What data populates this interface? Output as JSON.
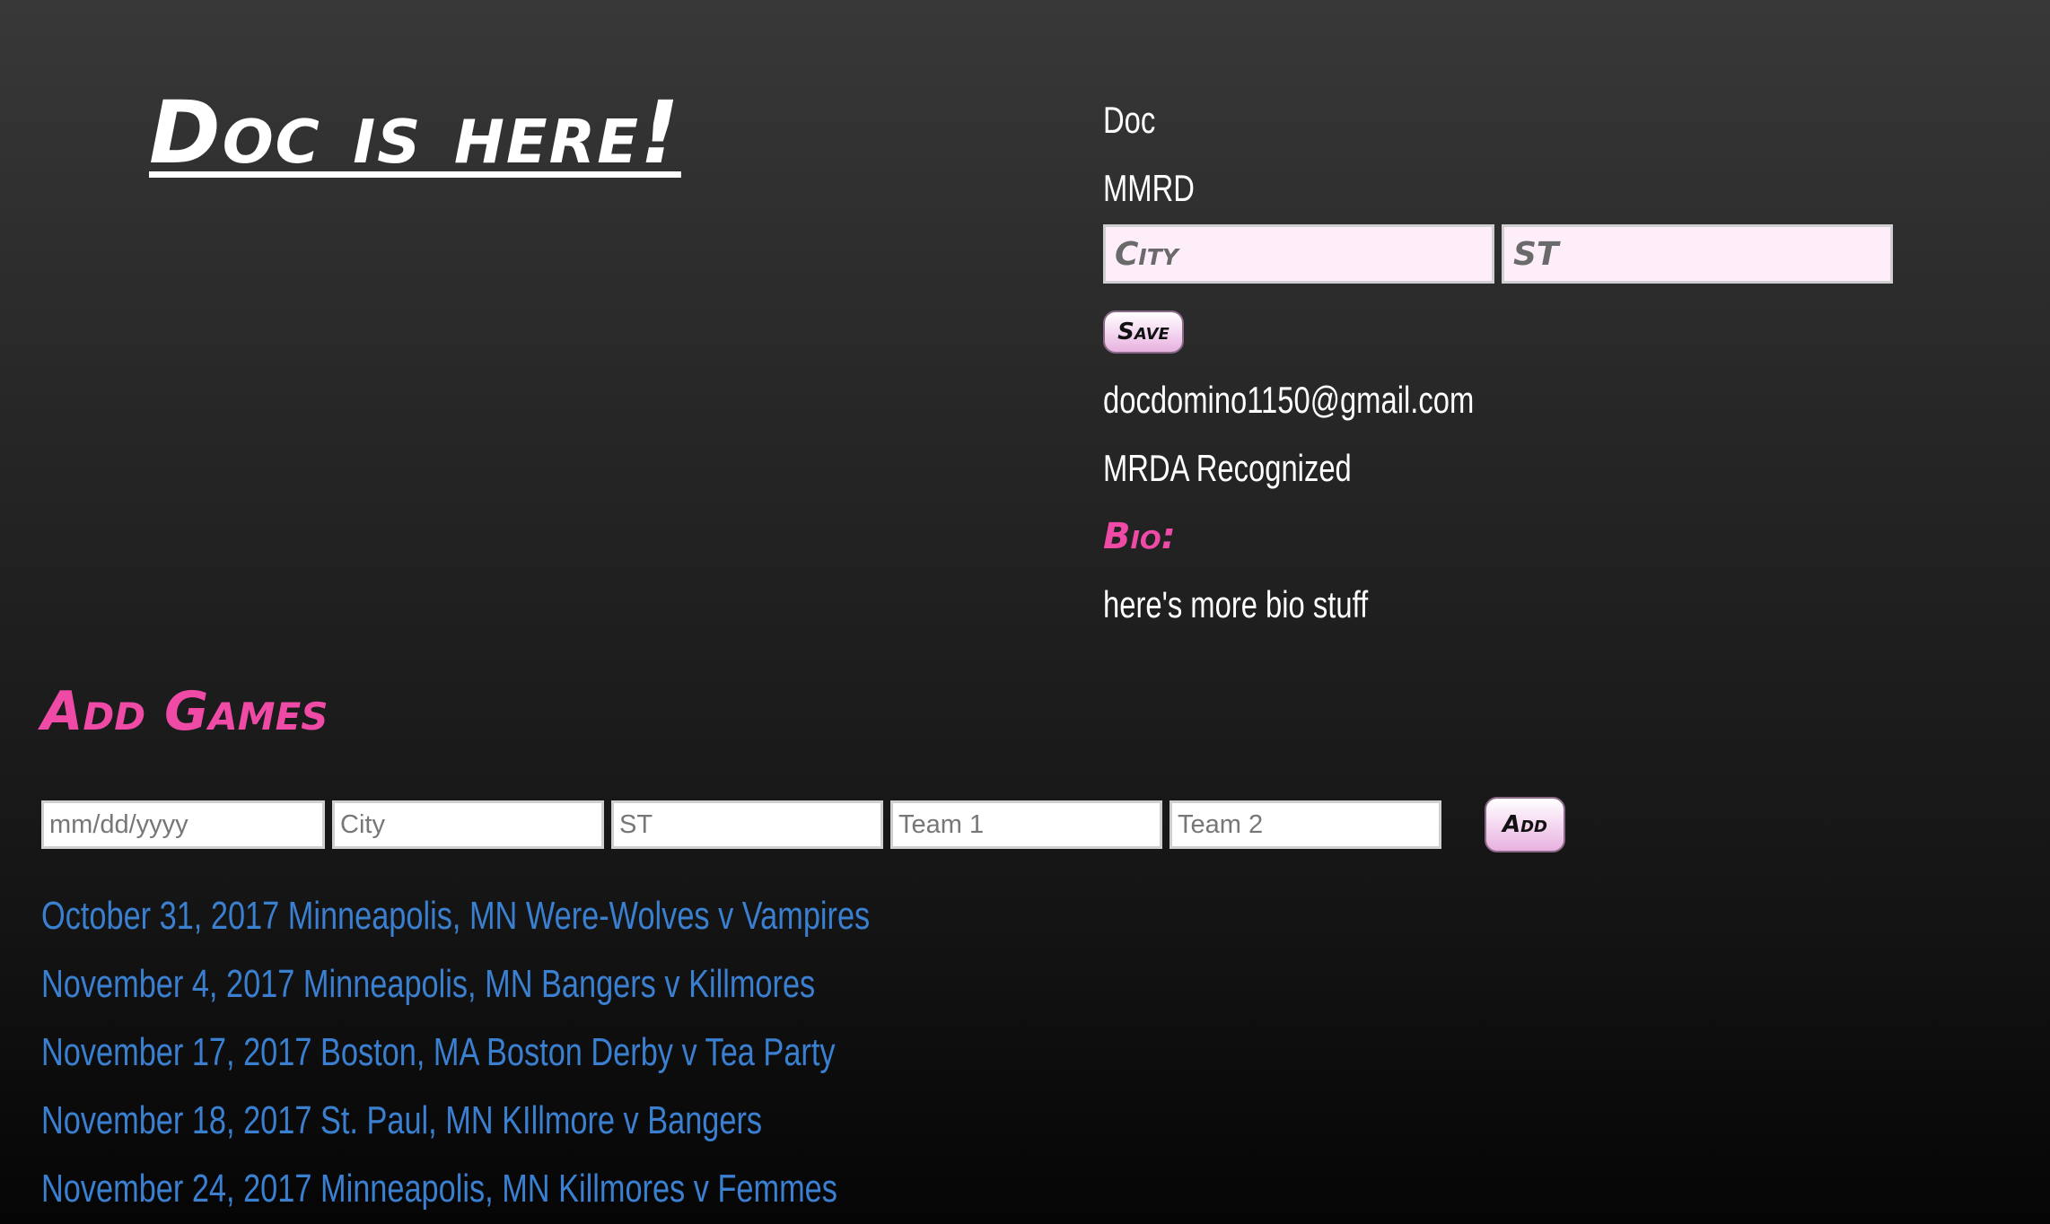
{
  "header": {
    "title": "Doc is here!"
  },
  "profile": {
    "name": "Doc",
    "team": "MMRD",
    "city_placeholder": "City",
    "state_placeholder": "ST",
    "save_label": "Save",
    "email": "docdomino1150@gmail.com",
    "status": "MRDA Recognized",
    "bio_label": "Bio:",
    "bio_text": "here's more bio stuff"
  },
  "add_games": {
    "title": "Add Games",
    "date_placeholder": "mm/dd/yyyy",
    "city_placeholder": "City",
    "state_placeholder": "ST",
    "team1_placeholder": "Team 1",
    "team2_placeholder": "Team 2",
    "add_label": "Add"
  },
  "games": [
    "October 31, 2017 Minneapolis, MN Were-Wolves v Vampires",
    "November 4, 2017 Minneapolis, MN Bangers v Killmores",
    "November 17, 2017 Boston, MA Boston Derby v Tea Party",
    "November 18, 2017 St. Paul, MN KIllmore v Bangers",
    "November 24, 2017 Minneapolis, MN Killmores v Femmes"
  ],
  "colors": {
    "accent_pink": "#ee4aa6",
    "link_blue": "#3a7fd0",
    "input_pink": "#fdeefa"
  }
}
